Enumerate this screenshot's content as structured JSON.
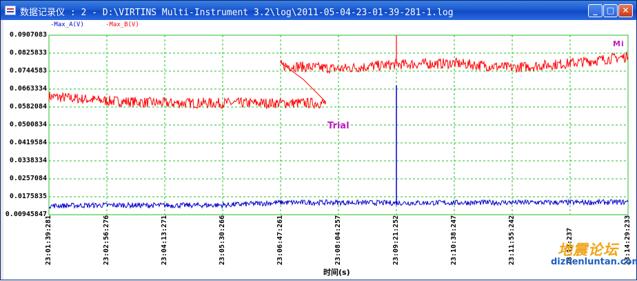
{
  "window": {
    "title": "数据记录仪 : 2 - D:\\VIRTINS Multi-Instrument 3.2\\log\\2011-05-04-23-01-39-281-1.log",
    "min_label": "_",
    "max_label": "□",
    "close_label": "✕"
  },
  "legend": {
    "a": "-Max_A(V)",
    "b": "-Max_B(V)"
  },
  "colors": {
    "series_a": "#0000cc",
    "series_b": "#ff0000",
    "grid": "#20c020",
    "annotation": "#c020c0"
  },
  "annotations": {
    "trial": "Trial",
    "mi": "Mi"
  },
  "watermark": {
    "text": "地震论坛",
    "url": "dizhenluntan.com"
  },
  "chart_data": {
    "type": "line",
    "xlabel": "时间(s)",
    "x_ticks": [
      "23:01:39:281",
      "23:02:56:276",
      "23:04:13:271",
      "23:05:30:266",
      "23:06:47:261",
      "23:08:04:257",
      "23:09:21:252",
      "23:10:38:247",
      "23:11:55:242",
      "23:12:237",
      "23:14:29:233"
    ],
    "y_ticks": [
      "0.0907083",
      "0.0825833",
      "0.0744583",
      "0.0663334",
      "0.0582084",
      "0.0500834",
      "0.0419584",
      "0.0338334",
      "0.0257084",
      "0.0175835",
      "0.00945847"
    ],
    "ylim": [
      0.00945847,
      0.0907083
    ],
    "grid": true,
    "series": [
      {
        "name": "Max_B(V)",
        "x": [
          "23:01:39:281",
          "23:02:56:276",
          "23:04:13:271",
          "23:05:30:266",
          "23:06:30",
          "23:06:47:261",
          "23:08:04:257",
          "23:09:21:252",
          "23:10:38:247",
          "23:11:55:242",
          "23:12:237",
          "23:14:29:233"
        ],
        "values": [
          0.063,
          0.061,
          0.06,
          0.06,
          0.06,
          0.077,
          0.0755,
          0.0775,
          0.078,
          0.076,
          0.078,
          0.081
        ]
      },
      {
        "name": "Max_A(V)",
        "x": [
          "23:01:39:281",
          "23:02:56:276",
          "23:04:13:271",
          "23:05:30:266",
          "23:06:47:261",
          "23:08:04:257",
          "23:09:21:252",
          "23:10:38:247",
          "23:11:55:242",
          "23:12:237",
          "23:14:29:233"
        ],
        "values": [
          0.0135,
          0.0138,
          0.0137,
          0.0138,
          0.015,
          0.015,
          0.0148,
          0.0149,
          0.015,
          0.015,
          0.0152
        ]
      }
    ],
    "spike": {
      "x": "23:09:21:252",
      "value": 0.068
    }
  }
}
